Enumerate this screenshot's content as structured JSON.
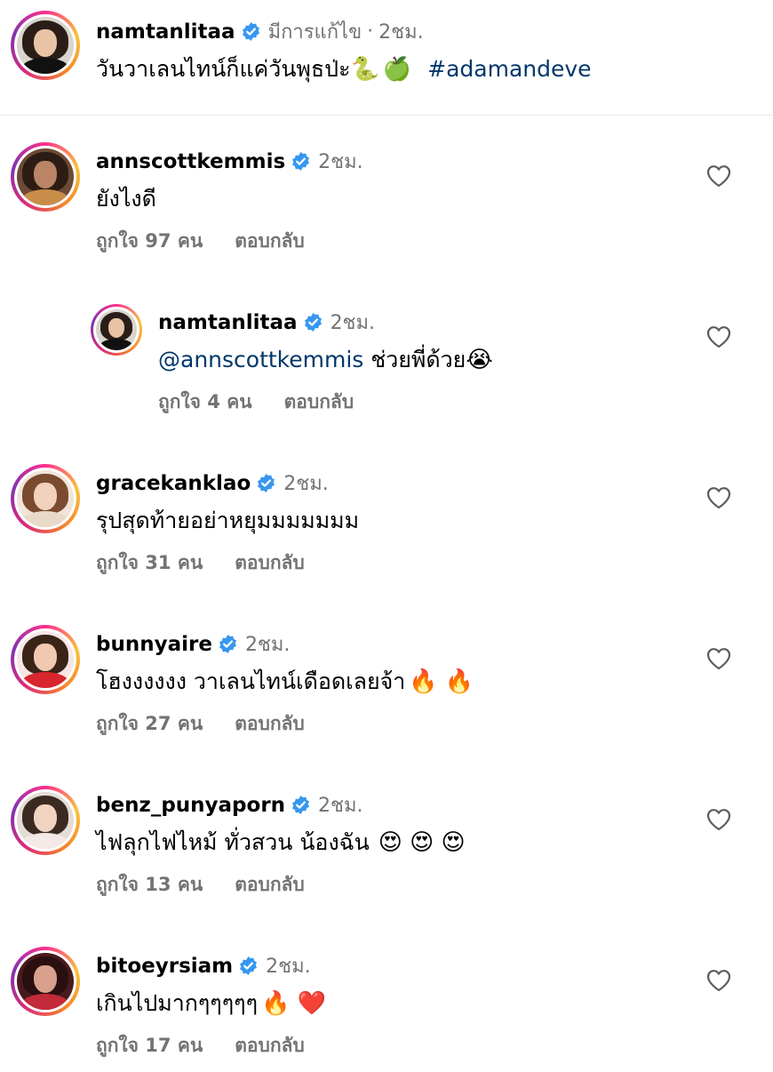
{
  "caption": {
    "username": "namtanlitaa",
    "edited": "มีการแก้ไข",
    "separator": "·",
    "time": "2ชม.",
    "text": "วันวาเลนไทน์ก็แค่วันพุธป่ะ",
    "emoji1": "🐍",
    "emoji2": "🍏",
    "hashtag": "#adamandeve"
  },
  "comments": [
    {
      "username": "annscottkemmis",
      "time": "2ชม.",
      "text": "ยังไงดี",
      "likes": "ถูกใจ 97 คน",
      "reply": "ตอบกลับ"
    },
    {
      "username": "namtanlitaa",
      "time": "2ชม.",
      "mention": "@annscottkemmis",
      "text": " ช่วยพี่ด้วย",
      "emoji": "😭",
      "likes": "ถูกใจ 4 คน",
      "reply": "ตอบกลับ"
    },
    {
      "username": "gracekanklao",
      "time": "2ชม.",
      "text": "รุปสุดท้ายอย่าหยุมมมมมมม",
      "likes": "ถูกใจ 31 คน",
      "reply": "ตอบกลับ"
    },
    {
      "username": "bunnyaire",
      "time": "2ชม.",
      "text": "โฮงงงงงง วาเลนไทน์เดือดเลยจ้า",
      "emoji": "🔥 🔥",
      "likes": "ถูกใจ 27 คน",
      "reply": "ตอบกลับ"
    },
    {
      "username": "benz_punyaporn",
      "time": "2ชม.",
      "text": "ไฟลุกไฟไหม้ ทั่วสวน น้องฉัน",
      "emoji": "😍 😍 😍",
      "likes": "ถูกใจ 13 คน",
      "reply": "ตอบกลับ"
    },
    {
      "username": "bitoeyrsiam",
      "time": "2ชม.",
      "text": "เกินไปมากๆๆๆๆๆ",
      "emoji": "🔥 ❤️",
      "likes": "ถูกใจ 17 คน",
      "reply": "ตอบกลับ"
    }
  ],
  "colors": {
    "verified": "#3797f0",
    "meta": "#737373",
    "link": "#00376b"
  }
}
